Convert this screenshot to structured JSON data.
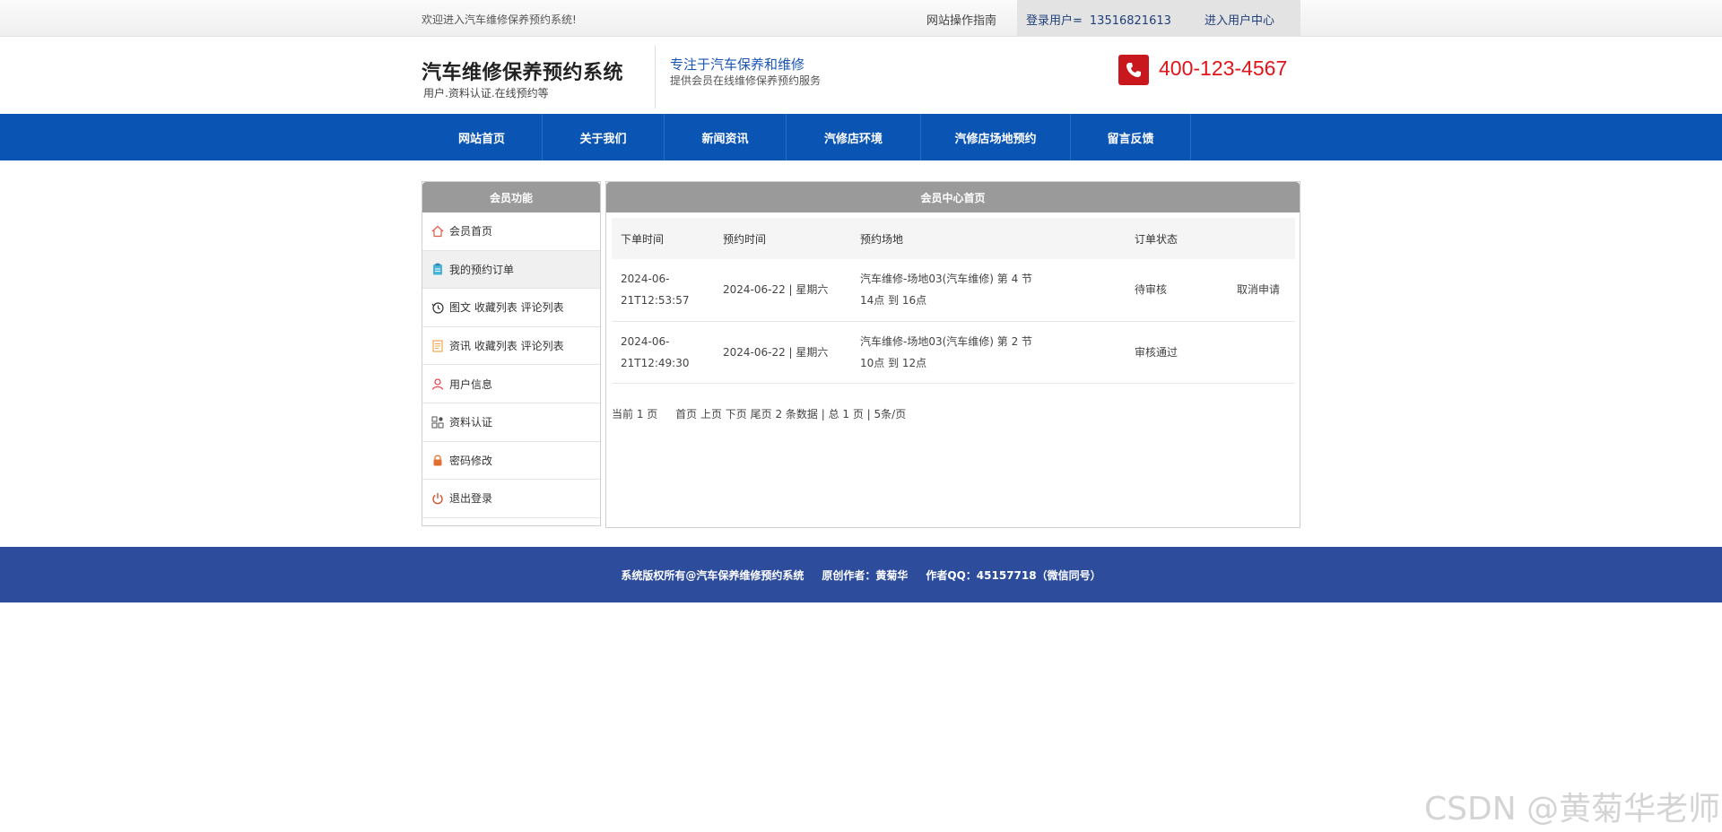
{
  "topbar": {
    "welcome": "欢迎进入汽车维修保养预约系统!",
    "guide": "网站操作指南",
    "login_label": "登录用户=",
    "login_user": "13516821613",
    "user_center": "进入用户中心"
  },
  "header": {
    "title": "汽车维修保养预约系统",
    "subtitle": "用户.资料认证.在线预约等",
    "slogan": "专注于汽车保养和维修",
    "slogan_sub": "提供会员在线维修保养预约服务",
    "hotline": "400-123-4567",
    "phone_icon": "phone-icon"
  },
  "nav": {
    "items": [
      "网站首页",
      "关于我们",
      "新闻资讯",
      "汽修店环境",
      "汽修店场地预约",
      "留言反馈"
    ]
  },
  "sidebar": {
    "title": "会员功能",
    "items": [
      {
        "label": "会员首页",
        "icon": "home-icon"
      },
      {
        "label": "我的预约订单",
        "icon": "clipboard-icon"
      },
      {
        "label": "图文 收藏列表 评论列表",
        "icon": "history-icon"
      },
      {
        "label": "资讯 收藏列表 评论列表",
        "icon": "document-icon"
      },
      {
        "label": "用户信息",
        "icon": "user-icon"
      },
      {
        "label": "资料认证",
        "icon": "grid-icon"
      },
      {
        "label": "密码修改",
        "icon": "lock-icon"
      },
      {
        "label": "退出登录",
        "icon": "power-icon"
      }
    ]
  },
  "main": {
    "title": "会员中心首页",
    "columns": [
      "下单时间",
      "预约时间",
      "预约场地",
      "订单状态",
      ""
    ],
    "rows": [
      {
        "order_time_1": "2024-06-",
        "order_time_2": "21T12:53:57",
        "appointment": "2024-06-22 | 星期六",
        "venue_1": "汽车维修-场地03(汽车维修) 第 4 节",
        "venue_2": "14点 到 16点",
        "status": "待审核",
        "action": "取消申请"
      },
      {
        "order_time_1": "2024-06-",
        "order_time_2": "21T12:49:30",
        "appointment": "2024-06-22 | 星期六",
        "venue_1": "汽车维修-场地03(汽车维修) 第 2 节",
        "venue_2": "10点 到 12点",
        "status": "审核通过",
        "action": ""
      }
    ],
    "pager": {
      "current": "当前 1 页",
      "first": "首页",
      "prev": "上页",
      "next": "下页",
      "last": "尾页",
      "summary": "2 条数据 | 总 1 页 | 5条/页"
    }
  },
  "footer": {
    "copyright": "系统版权所有@汽车保养维修预约系统",
    "author": "原创作者：黄菊华",
    "qq": "作者QQ：45157718（微信同号）"
  },
  "watermark": "CSDN @黄菊华老师",
  "colors": {
    "nav_blue": "#0a54b4",
    "footer_blue": "#2d4d9c",
    "hotline_red": "#e0141a",
    "panel_gray": "#9a9a9a"
  }
}
